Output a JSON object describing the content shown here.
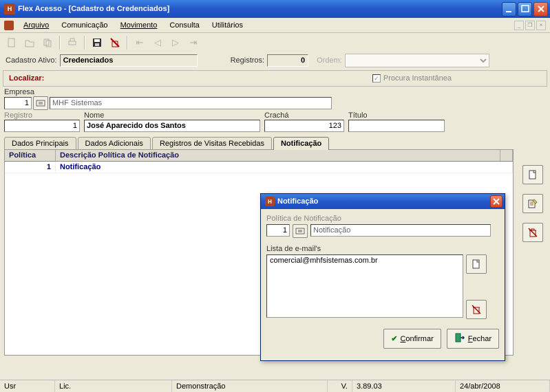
{
  "window": {
    "title": "Flex Acesso - [Cadastro de Credenciados]"
  },
  "menu": {
    "arquivo": "Arquivo",
    "comunicacao": "Comunicação",
    "movimento": "Movimento",
    "consulta": "Consulta",
    "utilitarios": "Utilitários"
  },
  "header": {
    "cadastro_ativo_label": "Cadastro Ativo:",
    "cadastro_ativo_value": "Credenciados",
    "registros_label": "Registros:",
    "registros_value": "0",
    "ordem_label": "Ordem:",
    "localizar_label": "Localizar:",
    "procura_label": "Procura Instantânea"
  },
  "empresa": {
    "label": "Empresa",
    "id": "1",
    "name": "MHF Sistemas"
  },
  "registro": {
    "label": "Registro",
    "value": "1",
    "nome_label": "Nome",
    "nome_value": "José Aparecido dos Santos",
    "cracha_label": "Crachá",
    "cracha_value": "123",
    "titulo_label": "Título",
    "titulo_value": ""
  },
  "tabs": {
    "dados_principais": "Dados Principais",
    "dados_adicionais": "Dados Adicionais",
    "registros_visitas": "Registros de Visitas Recebidas",
    "notificacao": "Notificação"
  },
  "grid": {
    "col_politica": "Política",
    "col_descricao": "Descrição Política de Notificação",
    "row": {
      "politica": "1",
      "descricao": "Notificação"
    }
  },
  "dialog": {
    "title": "Notificação",
    "politica_label": "Política de Notificação",
    "politica_id": "1",
    "politica_name": "Notificação",
    "lista_label": "Lista de e-mail's",
    "email": "comercial@mhfsistemas.com.br",
    "confirmar": "Confirmar",
    "fechar": "Fechar"
  },
  "status": {
    "usr": "Usr",
    "lic": "Lic.",
    "demo": "Demonstração",
    "v_label": "V.",
    "version": "3.89.03",
    "date": "24/abr/2008"
  }
}
